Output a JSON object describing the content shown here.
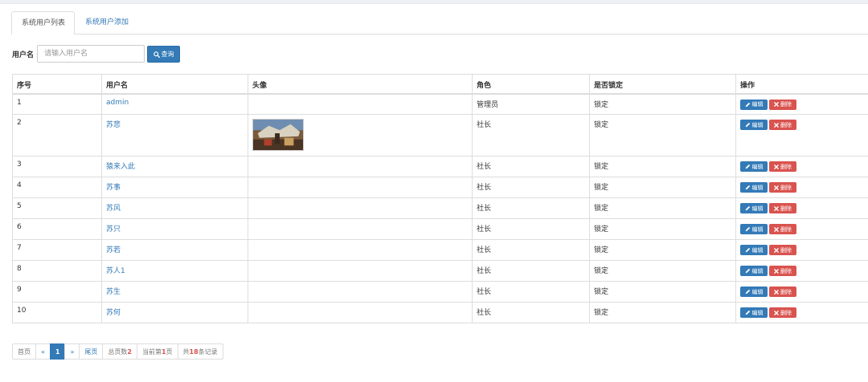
{
  "tabs": {
    "active": "系统用户列表",
    "other": "系统用户添加"
  },
  "search": {
    "label": "用户名",
    "placeholder": "请输入用户名",
    "value": "",
    "button": "查询"
  },
  "table": {
    "headers": [
      "序号",
      "用户名",
      "头像",
      "角色",
      "是否锁定",
      "操作"
    ],
    "rows": [
      {
        "no": "1",
        "name": "admin",
        "role": "管理员",
        "locked": "锁定",
        "avatar": false
      },
      {
        "no": "2",
        "name": "苏悲",
        "role": "社长",
        "locked": "锁定",
        "avatar": true
      },
      {
        "no": "3",
        "name": "猿来入此",
        "role": "社长",
        "locked": "锁定",
        "avatar": false
      },
      {
        "no": "4",
        "name": "苏事",
        "role": "社长",
        "locked": "锁定",
        "avatar": false
      },
      {
        "no": "5",
        "name": "苏风",
        "role": "社长",
        "locked": "锁定",
        "avatar": false
      },
      {
        "no": "6",
        "name": "苏只",
        "role": "社长",
        "locked": "锁定",
        "avatar": false
      },
      {
        "no": "7",
        "name": "苏若",
        "role": "社长",
        "locked": "锁定",
        "avatar": false
      },
      {
        "no": "8",
        "name": "苏人1",
        "role": "社长",
        "locked": "锁定",
        "avatar": false
      },
      {
        "no": "9",
        "name": "苏生",
        "role": "社长",
        "locked": "锁定",
        "avatar": false
      },
      {
        "no": "10",
        "name": "苏何",
        "role": "社长",
        "locked": "锁定",
        "avatar": false
      }
    ],
    "edit_label": "编辑",
    "delete_label": "删除"
  },
  "pager": {
    "first": "首页",
    "prev": "«",
    "current": "1",
    "next": "»",
    "last": "尾页",
    "total_pages_prefix": "总页数",
    "total_pages": "2",
    "current_page_prefix": "当前第",
    "current_page": "1",
    "current_page_suffix": "页",
    "records_prefix": "共",
    "records": "18",
    "records_suffix": "条记录"
  },
  "colors": {
    "primary": "#337ab7",
    "danger": "#d9534f",
    "border": "#dddddd"
  },
  "icons": {
    "search": "search-icon",
    "edit": "pencil-icon",
    "delete": "close-icon"
  }
}
